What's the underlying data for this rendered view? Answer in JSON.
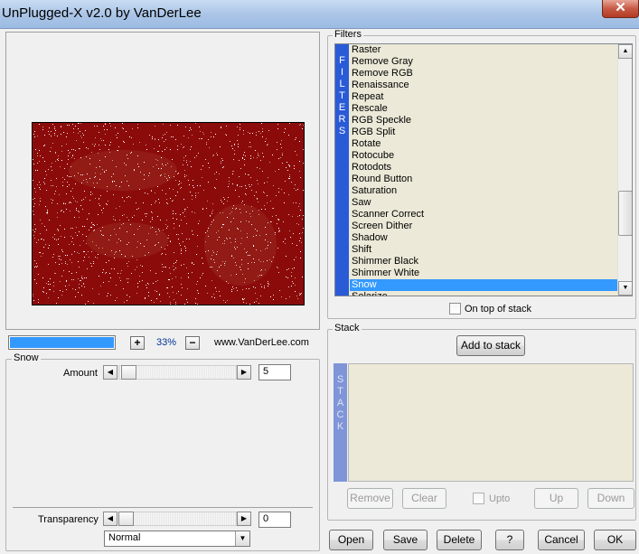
{
  "window": {
    "title": "UnPlugged-X v2.0 by VanDerLee",
    "close_label": "✕"
  },
  "preview": {
    "zoom_label": "33%",
    "zoom_in": "+",
    "zoom_out": "−",
    "website": "www.VanDerLee.com",
    "progress_fraction": 1.0
  },
  "snow_group": {
    "title": "Snow",
    "amount": {
      "label": "Amount",
      "value": "5",
      "slider_fraction": 0.03
    }
  },
  "transparency": {
    "label": "Transparency",
    "value": "0",
    "slider_fraction": 0.0
  },
  "blend_mode": {
    "selected": "Normal"
  },
  "filters": {
    "title": "Filters",
    "bar_letters": [
      "F",
      "I",
      "L",
      "T",
      "E",
      "R",
      "S"
    ],
    "items": [
      "Raster",
      "Remove Gray",
      "Remove RGB",
      "Renaissance",
      "Repeat",
      "Rescale",
      "RGB Speckle",
      "RGB Split",
      "Rotate",
      "Rotocube",
      "Rotodots",
      "Round Button",
      "Saturation",
      "Saw",
      "Scanner Correct",
      "Screen Dither",
      "Shadow",
      "Shift",
      "Shimmer Black",
      "Shimmer White",
      "Snow",
      "Solarize"
    ],
    "selected_index": 20,
    "on_top_of_stack_label": "On top of stack"
  },
  "stack": {
    "title": "Stack",
    "add_button": "Add to stack",
    "bar_letters": [
      "S",
      "T",
      "A",
      "C",
      "K"
    ],
    "remove_button": "Remove",
    "clear_button": "Clear",
    "upto_label": "Upto",
    "up_button": "Up",
    "down_button": "Down"
  },
  "footer": {
    "open": "Open",
    "save": "Save",
    "delete": "Delete",
    "help": "?",
    "cancel": "Cancel",
    "ok": "OK"
  },
  "colors": {
    "selection": "#3399ff",
    "filters_bar": "#2a5bd7",
    "stack_bar": "#7f95d8",
    "preview_background": "#8b0b0b"
  }
}
